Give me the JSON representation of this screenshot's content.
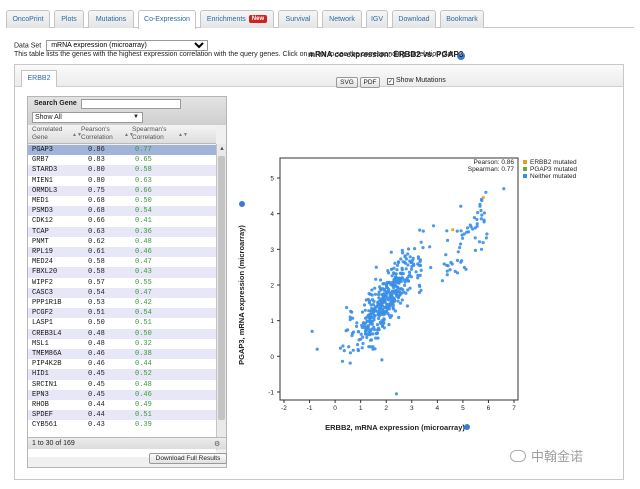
{
  "tabs": [
    {
      "label": "OncoPrint",
      "active": false
    },
    {
      "label": "Plots",
      "active": false
    },
    {
      "label": "Mutations",
      "active": false
    },
    {
      "label": "Co-Expression",
      "active": true
    },
    {
      "label": "Enrichments",
      "active": false,
      "badge": "New"
    },
    {
      "label": "Survival",
      "active": false
    },
    {
      "label": "Network",
      "active": false
    },
    {
      "label": "IGV",
      "active": false
    },
    {
      "label": "Download",
      "active": false
    },
    {
      "label": "Bookmark",
      "active": false
    }
  ],
  "dataset": {
    "label": "Data Set",
    "selected": "mRNA expression (microarray)"
  },
  "description": "This table lists the genes with the highest expression correlation with the query genes. Click on a row to see the corresponding correlation plot.",
  "gene_tab": "ERBB2",
  "table": {
    "search_label": "Search Gene",
    "search_value": "",
    "filter_selected": "Show All",
    "headers": {
      "gene": "Correlated Gene",
      "pearson": "Pearson's Correlation",
      "spearman": "Spearman's Correlation"
    },
    "rows": [
      {
        "gene": "PGAP3",
        "pearson": "0.86",
        "spearman": "0.77"
      },
      {
        "gene": "GRB7",
        "pearson": "0.83",
        "spearman": "0.65"
      },
      {
        "gene": "STARD3",
        "pearson": "0.80",
        "spearman": "0.58"
      },
      {
        "gene": "MIEN1",
        "pearson": "0.80",
        "spearman": "0.63"
      },
      {
        "gene": "ORMDL3",
        "pearson": "0.75",
        "spearman": "0.66"
      },
      {
        "gene": "MED1",
        "pearson": "0.68",
        "spearman": "0.50"
      },
      {
        "gene": "PSMD3",
        "pearson": "0.68",
        "spearman": "0.54"
      },
      {
        "gene": "CDK12",
        "pearson": "0.66",
        "spearman": "0.41"
      },
      {
        "gene": "TCAP",
        "pearson": "0.63",
        "spearman": "0.36"
      },
      {
        "gene": "PNMT",
        "pearson": "0.62",
        "spearman": "0.48"
      },
      {
        "gene": "RPL19",
        "pearson": "0.61",
        "spearman": "0.46"
      },
      {
        "gene": "MED24",
        "pearson": "0.58",
        "spearman": "0.47"
      },
      {
        "gene": "FBXL20",
        "pearson": "0.58",
        "spearman": "0.43"
      },
      {
        "gene": "WIPF2",
        "pearson": "0.57",
        "spearman": "0.55"
      },
      {
        "gene": "CASC3",
        "pearson": "0.54",
        "spearman": "0.47"
      },
      {
        "gene": "PPP1R1B",
        "pearson": "0.53",
        "spearman": "0.42"
      },
      {
        "gene": "PCGF2",
        "pearson": "0.51",
        "spearman": "0.54"
      },
      {
        "gene": "LASP1",
        "pearson": "0.50",
        "spearman": "0.51"
      },
      {
        "gene": "CREB3L4",
        "pearson": "0.48",
        "spearman": "0.50"
      },
      {
        "gene": "MSL1",
        "pearson": "0.48",
        "spearman": "0.32"
      },
      {
        "gene": "TMEM86A",
        "pearson": "0.46",
        "spearman": "0.38"
      },
      {
        "gene": "PIP4K2B",
        "pearson": "0.46",
        "spearman": "0.44"
      },
      {
        "gene": "HID1",
        "pearson": "0.45",
        "spearman": "0.52"
      },
      {
        "gene": "SRCIN1",
        "pearson": "0.45",
        "spearman": "0.48"
      },
      {
        "gene": "EPN3",
        "pearson": "0.45",
        "spearman": "0.46"
      },
      {
        "gene": "RHOB",
        "pearson": "0.44",
        "spearman": "0.49"
      },
      {
        "gene": "SPDEF",
        "pearson": "0.44",
        "spearman": "0.51"
      },
      {
        "gene": "CYB561",
        "pearson": "0.43",
        "spearman": "0.39"
      }
    ],
    "info": "1 to 30 of 169",
    "download_label": "Download Full Results"
  },
  "plot": {
    "title": "mRNA co-expression: ERBB2 vs. PGAP3",
    "svg_label": "SVG",
    "pdf_label": "PDF",
    "show_mutations_label": "Show Mutations",
    "show_mutations_checked": true,
    "pearson_text": "Pearson: 0.86",
    "spearman_text": "Spearman: 0.77"
  },
  "chart_data": {
    "type": "scatter",
    "title": "mRNA co-expression: ERBB2 vs. PGAP3",
    "xlabel": "ERBB2, mRNA expression (microarray)",
    "ylabel": "PGAP3, mRNA expression (microarray)",
    "xlim": [
      -2,
      7
    ],
    "ylim": [
      -1,
      5
    ],
    "xticks": [
      -2,
      -1,
      0,
      1,
      2,
      3,
      4,
      5,
      6,
      7
    ],
    "yticks": [
      -1,
      0,
      1,
      2,
      3,
      4,
      5
    ],
    "grid": false,
    "legend_position": "top-right",
    "series": [
      {
        "name": "ERBB2 mutated",
        "color": "#e0a020",
        "points": [
          [
            4.6,
            3.55
          ],
          [
            5.8,
            4.45
          ]
        ]
      },
      {
        "name": "PGAP3 mutated",
        "color": "#66aa33",
        "points": []
      },
      {
        "name": "Neither mutated",
        "color": "#3a8ee6",
        "points": []
      }
    ],
    "pearson": 0.86,
    "spearman": 0.77
  },
  "watermark": "中翰金诺"
}
